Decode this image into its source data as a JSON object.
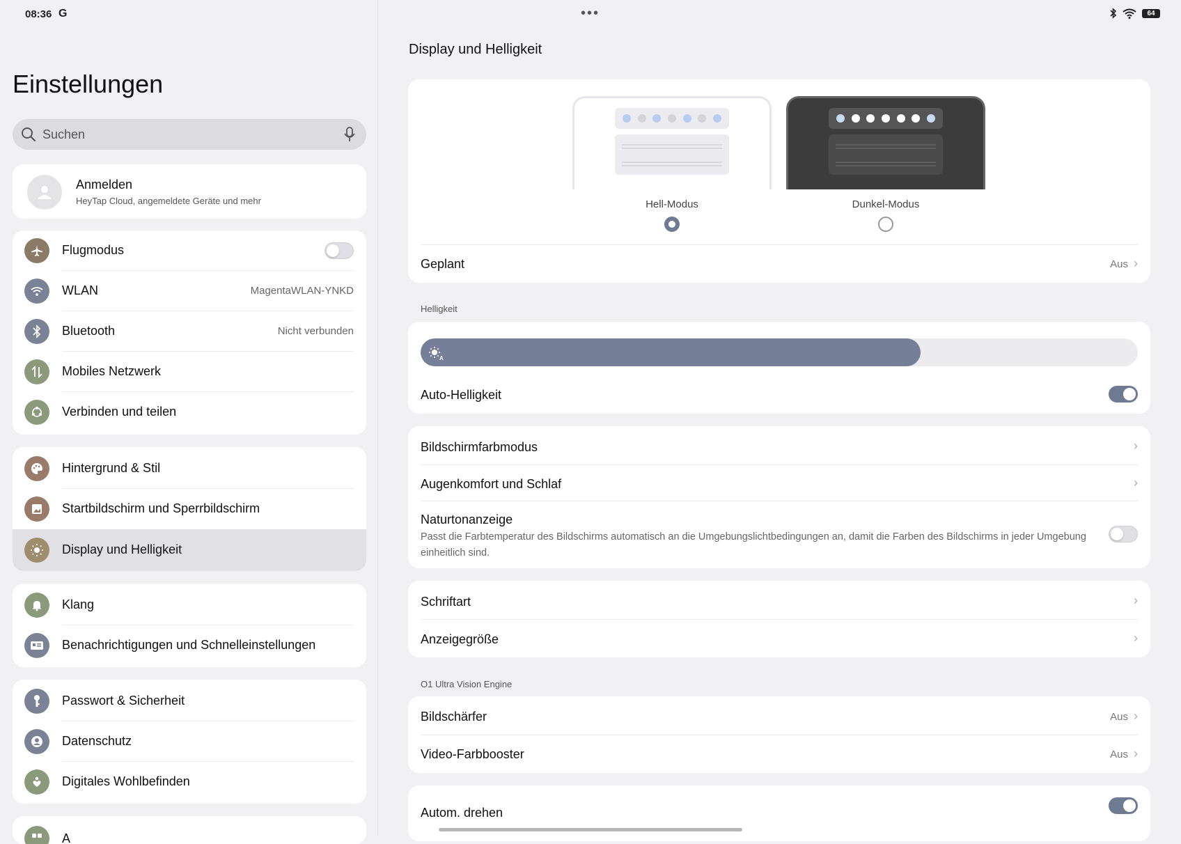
{
  "status": {
    "time": "08:36",
    "provider_glyph": "G",
    "battery": "64"
  },
  "sidebar": {
    "title": "Einstellungen",
    "search_placeholder": "Suchen",
    "account": {
      "name": "Anmelden",
      "subtitle": "HeyTap Cloud, angemeldete Geräte und mehr"
    },
    "groups": [
      {
        "items": [
          {
            "label": "Flugmodus",
            "value": "",
            "icon": "airplane-icon",
            "color": "#8b7a66"
          },
          {
            "label": "WLAN",
            "value": "MagentaWLAN-YNKD",
            "icon": "wifi-icon",
            "color": "#7a8296"
          },
          {
            "label": "Bluetooth",
            "value": "Nicht verbunden",
            "icon": "bluetooth-icon",
            "color": "#7a8296"
          },
          {
            "label": "Mobiles Netzwerk",
            "value": "",
            "icon": "mobile-data-icon",
            "color": "#8a9a7a"
          },
          {
            "label": "Verbinden und teilen",
            "value": "",
            "icon": "share-icon",
            "color": "#8a9a7a"
          }
        ]
      },
      {
        "items": [
          {
            "label": "Hintergrund & Stil",
            "value": "",
            "icon": "palette-icon",
            "color": "#9a7a68"
          },
          {
            "label": "Startbildschirm und Sperrbildschirm",
            "value": "",
            "icon": "homescreen-icon",
            "color": "#9a7a68"
          },
          {
            "label": "Display und Helligkeit",
            "value": "",
            "icon": "sun-icon",
            "color": "#9e8e6e"
          }
        ]
      },
      {
        "items": [
          {
            "label": "Klang",
            "value": "",
            "icon": "bell-icon",
            "color": "#8a9a7a"
          },
          {
            "label": "Benachrichtigungen und Schnelleinstellungen",
            "value": "",
            "icon": "notification-icon",
            "color": "#7a8296"
          }
        ]
      },
      {
        "items": [
          {
            "label": "Passwort & Sicherheit",
            "value": "",
            "icon": "key-icon",
            "color": "#7a8296"
          },
          {
            "label": "Datenschutz",
            "value": "",
            "icon": "privacy-icon",
            "color": "#7a8296"
          },
          {
            "label": "Digitales Wohlbefinden",
            "value": "",
            "icon": "wellbeing-icon",
            "color": "#8a9a7a"
          }
        ]
      }
    ],
    "partial_item": "A"
  },
  "main": {
    "title": "Display und Helligkeit",
    "modes": {
      "light_label": "Hell-Modus",
      "dark_label": "Dunkel-Modus",
      "selected": "light"
    },
    "scheduled": {
      "label": "Geplant",
      "value": "Aus"
    },
    "brightness": {
      "section": "Helligkeit",
      "level": 0.697,
      "auto_label": "Auto-Helligkeit",
      "auto_on": true
    },
    "color": {
      "mode_label": "Bildschirmfarbmodus",
      "eye_label": "Augenkomfort und Schlaf",
      "natural_label": "Naturtonanzeige",
      "natural_desc": "Passt die Farbtemperatur des Bildschirms automatisch an die Umgebungslichtbedingungen an, damit die Farben des Bildschirms in jeder Umgebung einheitlich sind.",
      "natural_on": false
    },
    "font": {
      "font_label": "Schriftart",
      "size_label": "Anzeigegröße"
    },
    "vision": {
      "section": "O1 Ultra Vision Engine",
      "sharpener_label": "Bildschärfer",
      "sharpener_value": "Aus",
      "booster_label": "Video-Farbbooster",
      "booster_value": "Aus"
    },
    "rotate": {
      "label": "Autom. drehen",
      "on": true
    }
  },
  "colors": {
    "accent": "#6f7a93",
    "background": "#f1f1f3",
    "card": "#ffffff"
  }
}
